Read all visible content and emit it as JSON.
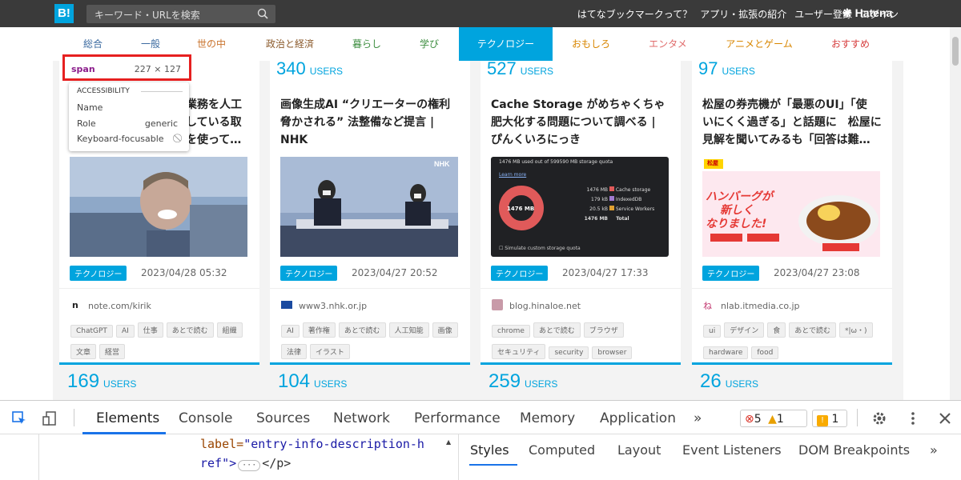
{
  "header": {
    "logo": "B!",
    "search_placeholder": "キーワード・URLを検索",
    "links": [
      "はてなブックマークって？",
      "アプリ・拡張の紹介",
      "ユーザー登録",
      "ログイン"
    ],
    "brand": "Hatena"
  },
  "categories": [
    "総合",
    "一般",
    "世の中",
    "政治と経済",
    "暮らし",
    "学び",
    "テクノロジー",
    "おもしろ",
    "エンタメ",
    "アニメとゲーム",
    "おすすめ"
  ],
  "category_colors": [
    "#3b6aa0",
    "#3b6aa0",
    "#c9722b",
    "#8b5a2b",
    "#3e8e41",
    "#3e8e41",
    "#ffffff",
    "#d88600",
    "#e06c6c",
    "#d88600",
    "#d63c3c"
  ],
  "active_category": "テクノロジー",
  "tooltip": {
    "tag": "span",
    "dims": "227 × 127",
    "section": "ACCESSIBILITY",
    "name_label": "Name",
    "role_label": "Role",
    "role_value": "generic",
    "kb_label": "Keyboard-focusable"
  },
  "cards": [
    {
      "users": "",
      "users_unit": "",
      "title_lines": [
        "業務を人工",
        "している取",
        "を使って…"
      ],
      "category": "テクノロジー",
      "date": "2023/04/28 05:32",
      "source": "note.com/kirik",
      "tags": [
        "ChatGPT",
        "AI",
        "仕事",
        "あとで読む",
        "組織",
        "文章",
        "経営"
      ],
      "bottom_users": "169"
    },
    {
      "users": "340",
      "users_unit": "USERS",
      "title_lines": [
        "画像生成AI “クリエーターの権利",
        "脅かされる” 法整備など提言 |",
        "NHK"
      ],
      "category": "テクノロジー",
      "date": "2023/04/27 20:52",
      "source": "www3.nhk.or.jp",
      "tags": [
        "AI",
        "著作権",
        "あとで読む",
        "人工知能",
        "画像",
        "法律",
        "イラスト"
      ],
      "bottom_users": "104"
    },
    {
      "users": "527",
      "users_unit": "USERS",
      "title_lines": [
        "Cache Storage がめちゃくちゃ",
        "肥大化する問題について調べる |",
        "ぴんくいろにっき"
      ],
      "category": "テクノロジー",
      "date": "2023/04/27 17:33",
      "source": "blog.hinaloe.net",
      "tags": [
        "chrome",
        "あとで読む",
        "ブラウザ",
        "セキュリティ",
        "security",
        "browser"
      ],
      "bottom_users": "259"
    },
    {
      "users": "97",
      "users_unit": "USERS",
      "title_lines": [
        "松屋の券売機が「最悪のUI」「使",
        "いにくく過ぎる」と話題に　松屋に",
        "見解を聞いてみるも「回答は難…"
      ],
      "category": "テクノロジー",
      "date": "2023/04/27 23:08",
      "source": "nlab.itmedia.co.jp",
      "tags": [
        "ui",
        "デザイン",
        "食",
        "あとで読む",
        "*|ω・)",
        "hardware",
        "food"
      ],
      "bottom_users": "26"
    }
  ],
  "users_label": "USERS",
  "cache_img": {
    "header": "1476 MB used out of 599590 MB storage quota",
    "link": "Learn more",
    "center": "1476 MB",
    "rows": [
      {
        "value": "1476 MB",
        "label": "Cache storage",
        "color": "#e05a5a"
      },
      {
        "value": "179 kB",
        "label": "IndexedDB",
        "color": "#a07ad0"
      },
      {
        "value": "20.5 kB",
        "label": "Service Workers",
        "color": "#e0a030"
      },
      {
        "value": "1476 MB",
        "label": "Total",
        "color": ""
      }
    ],
    "footer": "Simulate custom storage quota"
  },
  "matsuya_img": {
    "brand": "松屋",
    "headline1": "ハンバーグが",
    "headline2": "新しく",
    "headline3": "なりました!"
  },
  "devtools": {
    "tabs": [
      "Elements",
      "Console",
      "Sources",
      "Network",
      "Performance",
      "Memory",
      "Application"
    ],
    "more": "»",
    "errors": "5",
    "warnings": "1",
    "issues": "1",
    "code_line1_attr": "label=",
    "code_line1_val": "\"entry-info-description-h",
    "code_line2": "ref\">",
    "code_line2_tail": "</p>",
    "subtabs": [
      "Styles",
      "Computed",
      "Layout",
      "Event Listeners",
      "DOM Breakpoints"
    ],
    "subtabs_more": "»"
  }
}
